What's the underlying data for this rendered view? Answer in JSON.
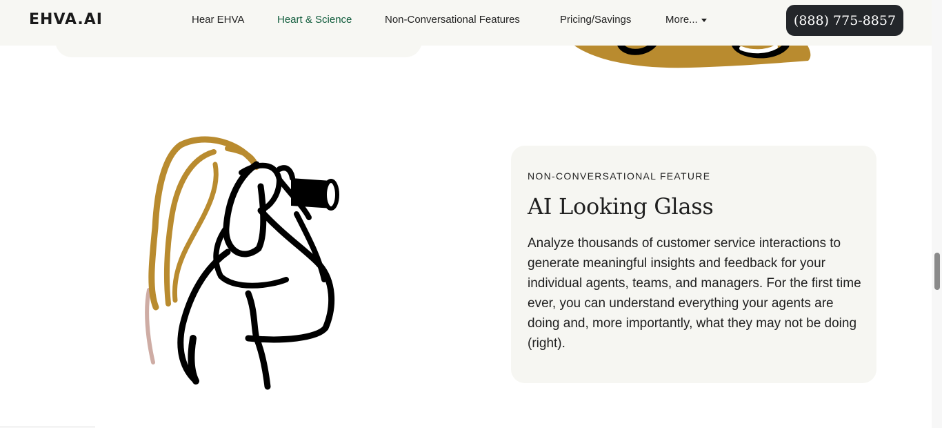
{
  "header": {
    "logo": "EHVA.AI",
    "nav": [
      {
        "label": "Hear EHVA",
        "active": false
      },
      {
        "label": "Heart & Science",
        "active": true
      },
      {
        "label": "Non-Conversational Features",
        "active": false
      },
      {
        "label": "Pricing/Savings",
        "active": false
      },
      {
        "label": "More...",
        "active": false
      }
    ],
    "phone": "(888) 775-8857"
  },
  "feature": {
    "eyebrow": "NON-CONVERSATIONAL FEATURE",
    "title": "AI Looking Glass",
    "body": "Analyze thousands of customer service interactions to generate meaningful insights and feedback for your individual agents, teams, and managers. For the first time ever, you can understand everything your agents are doing and, more importantly, what they may not be doing (right).",
    "illustration": "person-with-spyglass-illustration"
  },
  "colors": {
    "header_bg": "#f7f7f3",
    "card_bg": "#f6f6f2",
    "accent_green": "#0f5b3b",
    "button_dark": "#23262a",
    "illustration_gold": "#b98b2f",
    "illustration_ink": "#000000"
  }
}
